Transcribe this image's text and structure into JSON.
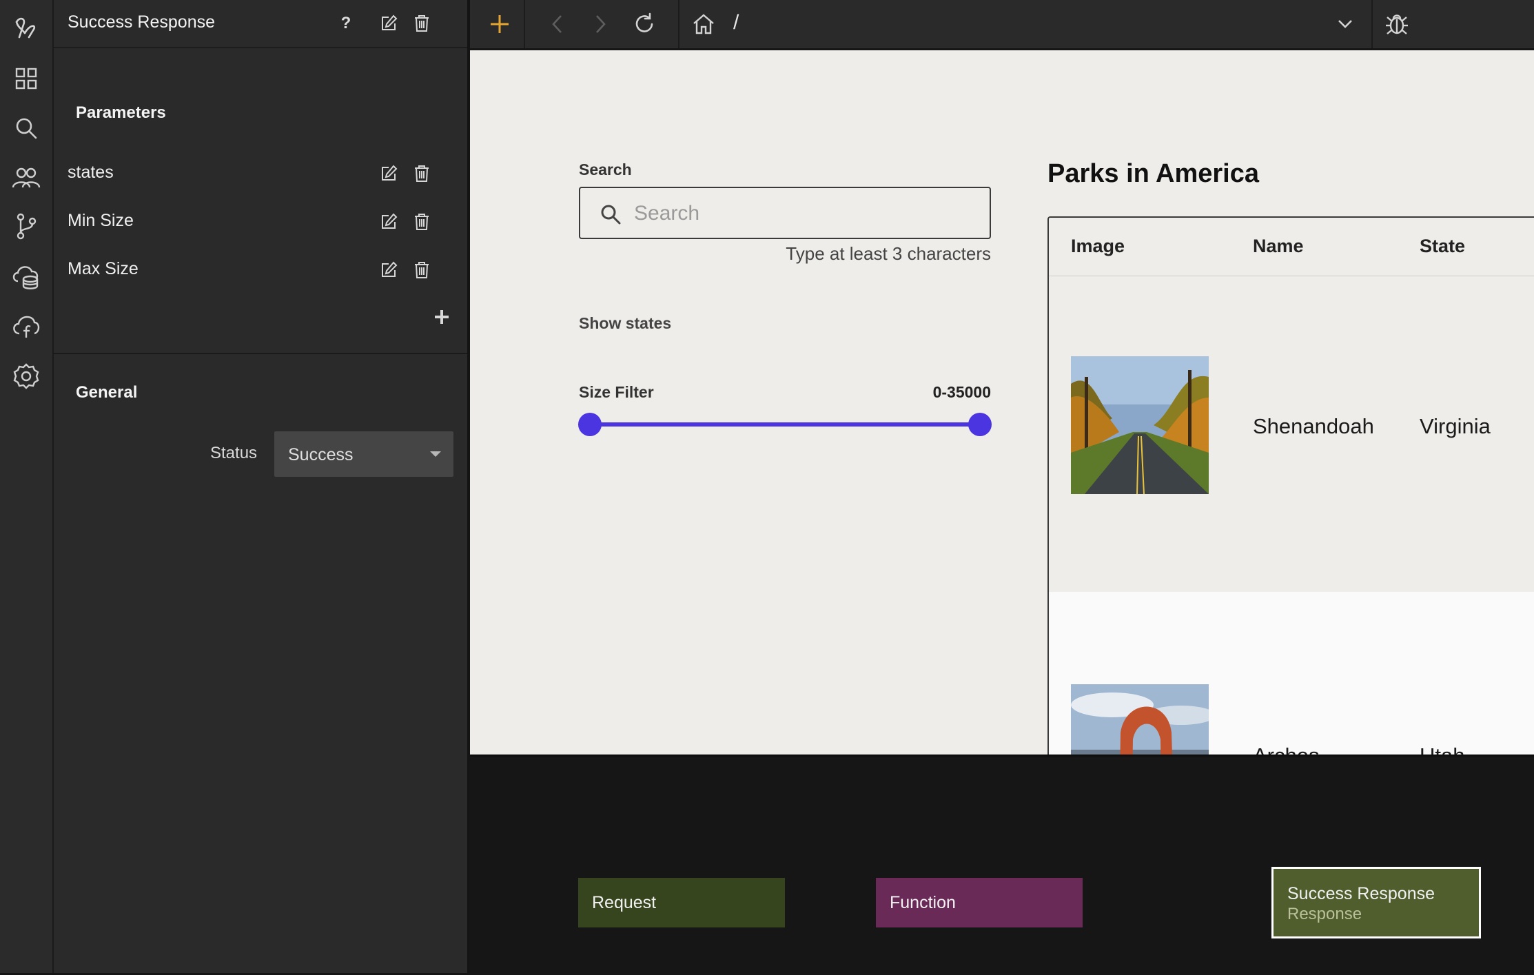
{
  "panel": {
    "title": "Success Response",
    "parameters_heading": "Parameters",
    "parameters": [
      {
        "label": "states"
      },
      {
        "label": "Min Size"
      },
      {
        "label": "Max Size"
      }
    ],
    "general_heading": "General",
    "status_label": "Status",
    "status_value": "Success"
  },
  "toolbar": {
    "url": "/"
  },
  "preview": {
    "search_label": "Search",
    "search_placeholder": "Search",
    "search_helper": "Type at least 3 characters",
    "show_states": "Show states",
    "size_filter_label": "Size Filter",
    "size_filter_value": "0-35000",
    "slider_min_fraction": 0,
    "slider_max_fraction": 1,
    "parks_title": "Parks in America",
    "table": {
      "columns": [
        "Image",
        "Name",
        "State"
      ],
      "rows": [
        {
          "name": "Shenandoah",
          "state": "Virginia",
          "image_icon": "autumn-road-photo"
        },
        {
          "name": "Arches",
          "state": "Utah",
          "image_icon": "stone-arch-photo"
        }
      ]
    }
  },
  "canvas": {
    "nodes": [
      {
        "title": "Request",
        "color": "#37451e"
      },
      {
        "title": "Function",
        "color": "#6a2a58"
      },
      {
        "title": "Success Response",
        "subtitle": "Response",
        "color": "#4f5e2c"
      }
    ]
  },
  "colors": {
    "accent_add": "#e5a631",
    "slider": "#4a35e0"
  }
}
